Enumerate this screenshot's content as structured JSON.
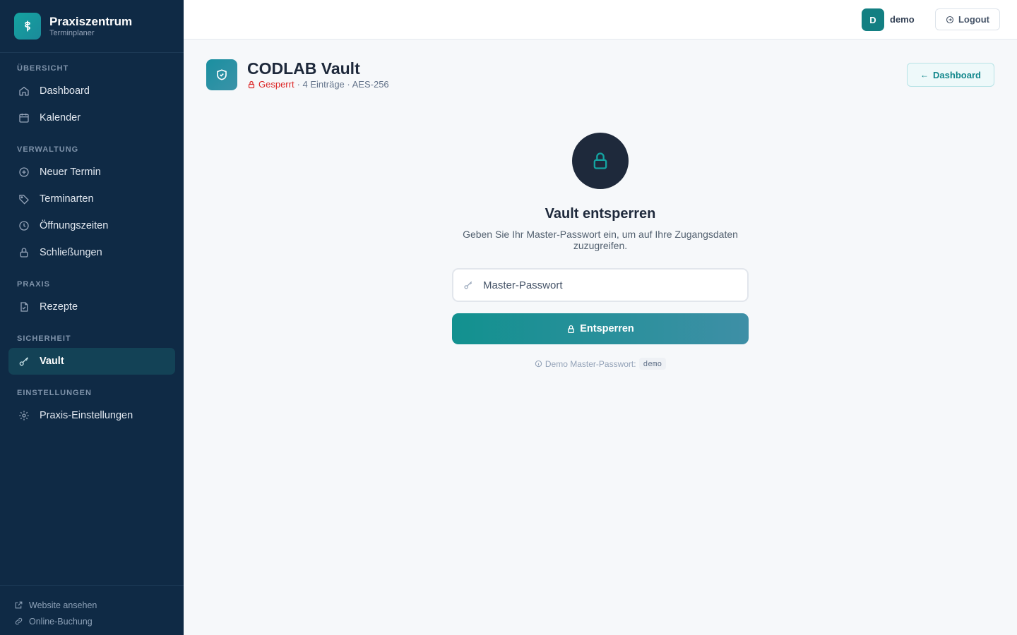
{
  "brand": {
    "name": "Praxiszentrum",
    "subtitle": "Terminplaner"
  },
  "sidebar": {
    "sections": [
      {
        "label": "ÜBERSICHT"
      },
      {
        "label": "VERWALTUNG"
      },
      {
        "label": "PRAXIS"
      },
      {
        "label": "SICHERHEIT"
      },
      {
        "label": "EINSTELLUNGEN"
      }
    ],
    "items": [
      {
        "label": "Dashboard",
        "icon": "home-icon"
      },
      {
        "label": "Kalender",
        "icon": "calendar-icon"
      },
      {
        "label": "Neuer Termin",
        "icon": "plus-circle-icon"
      },
      {
        "label": "Terminarten",
        "icon": "tag-icon"
      },
      {
        "label": "Öffnungszeiten",
        "icon": "clock-icon"
      },
      {
        "label": "Schließungen",
        "icon": "lock-icon"
      },
      {
        "label": "Rezepte",
        "icon": "document-icon"
      },
      {
        "label": "Vault",
        "icon": "key-icon",
        "active": true
      },
      {
        "label": "Praxis-Einstellungen",
        "icon": "gear-icon"
      }
    ],
    "footer": [
      {
        "label": "Website ansehen",
        "icon": "external-link-icon"
      },
      {
        "label": "Online-Buchung",
        "icon": "link-icon"
      }
    ]
  },
  "topbar": {
    "avatar_initial": "D",
    "username": "demo",
    "logout_label": "Logout"
  },
  "header": {
    "title": "CODLAB Vault",
    "status": "Gesperrt",
    "meta": "· 4 Einträge · AES-256",
    "back_label": "Dashboard"
  },
  "unlock": {
    "title": "Vault entsperren",
    "description": "Geben Sie Ihr Master-Passwort ein, um auf Ihre Zugangsdaten zuzugreifen.",
    "input_placeholder": "Master-Passwort",
    "button_label": "Entsperren",
    "hint_label": "Demo Master-Passwort:",
    "hint_value": "demo"
  },
  "colors": {
    "sidebar_bg": "#0f2a45",
    "accent": "#14918f",
    "locked": "#dc2626"
  }
}
